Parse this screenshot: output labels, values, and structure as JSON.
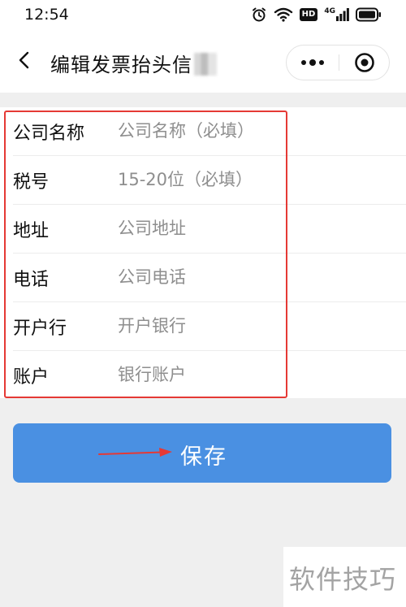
{
  "status_bar": {
    "time": "12:54",
    "hd_badge": "HD",
    "network": "4G"
  },
  "nav": {
    "title": "编辑发票抬头信"
  },
  "form": {
    "fields": [
      {
        "label": "公司名称",
        "placeholder": "公司名称（必填）",
        "value": ""
      },
      {
        "label": "税号",
        "placeholder": "15-20位（必填）",
        "value": ""
      },
      {
        "label": "地址",
        "placeholder": "公司地址",
        "value": ""
      },
      {
        "label": "电话",
        "placeholder": "公司电话",
        "value": ""
      },
      {
        "label": "开户行",
        "placeholder": "开户银行",
        "value": ""
      },
      {
        "label": "账户",
        "placeholder": "银行账户",
        "value": ""
      }
    ]
  },
  "save_button": {
    "label": "保存"
  },
  "watermark": {
    "text": "软件技巧"
  },
  "colors": {
    "accent": "#4a90e2",
    "annotation": "#e53935",
    "page_bg": "#efefef",
    "placeholder": "#8e8e8e"
  }
}
